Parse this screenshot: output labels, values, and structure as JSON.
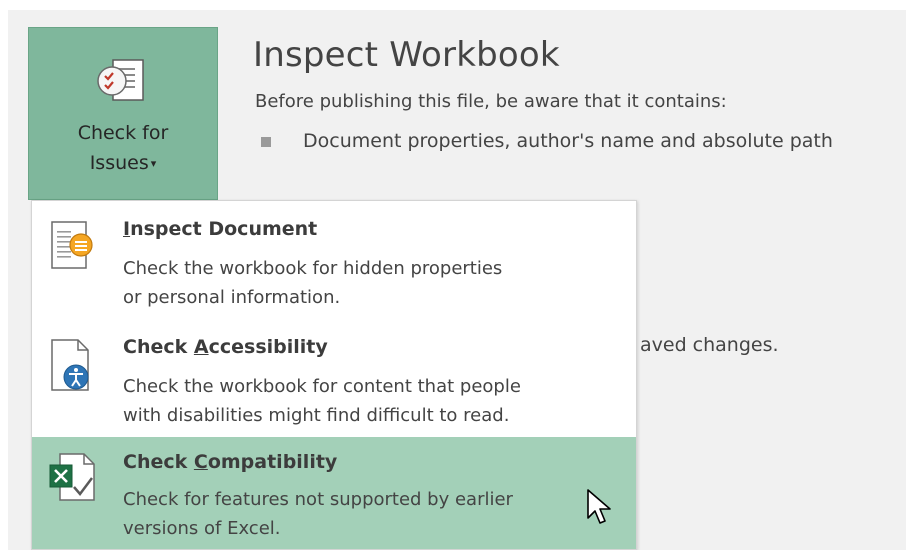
{
  "check_button": {
    "line1": "Check for",
    "line2": "Issues",
    "caret": "▾",
    "icon": "checklist-icon"
  },
  "inspect": {
    "title": "Inspect Workbook",
    "description": "Before publishing this file, be aware that it contains:",
    "bullets": [
      "Document properties, author's name and absolute path"
    ],
    "partial_text": "aved changes."
  },
  "menu": {
    "items": [
      {
        "title_pre": "I",
        "title_underline": "",
        "title_post": "nspect Document",
        "title_first_underlined": "I",
        "desc1": "Check the workbook for hidden properties",
        "desc2": "or personal information.",
        "icon": "inspect-document-icon"
      },
      {
        "title_pre": "Check ",
        "title_underline": "A",
        "title_post": "ccessibility",
        "desc1": "Check the workbook for content that people",
        "desc2": "with disabilities might find difficult to read.",
        "icon": "accessibility-icon"
      },
      {
        "title_pre": "Check ",
        "title_underline": "C",
        "title_post": "ompatibility",
        "desc1": "Check for features not supported by earlier",
        "desc2": "versions of Excel.",
        "icon": "compatibility-icon",
        "highlighted": true
      }
    ]
  },
  "colors": {
    "button_bg": "#7fb79c",
    "highlight_bg": "#a3d0b8",
    "page_bg": "#f1f1f1"
  }
}
